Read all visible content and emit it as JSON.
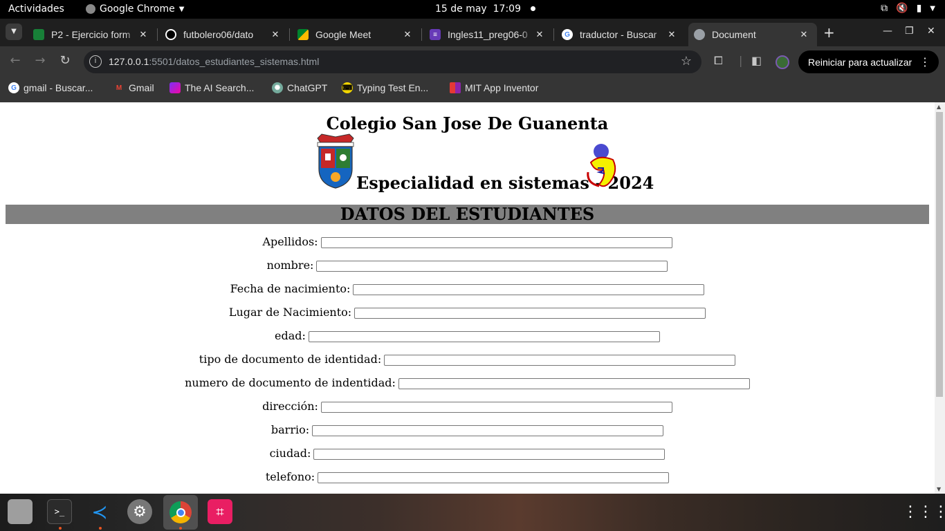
{
  "system_bar": {
    "activities": "Actividades",
    "app_name": "Google Chrome",
    "date": "15 de may",
    "time": "17:09"
  },
  "tabs": [
    {
      "title": "P2 - Ejercicio form",
      "fav_color": "#188038",
      "active": false
    },
    {
      "title": "futbolero06/dato",
      "fav_color": "#000000",
      "active": false
    },
    {
      "title": "Google Meet",
      "fav_color": "#00832d",
      "active": false
    },
    {
      "title": "Ingles11_preg06-0",
      "fav_color": "#673ab7",
      "active": false
    },
    {
      "title": "traductor - Buscar",
      "fav_color": "#4285f4",
      "active": false
    },
    {
      "title": "Document",
      "fav_color": "#9aa0a6",
      "active": true
    }
  ],
  "toolbar": {
    "url_host": "127.0.0.1",
    "url_path": ":5501/datos_estudiantes_sistemas.html",
    "update_label": "Reiniciar para actualizar"
  },
  "bookmarks": [
    {
      "label": "gmail - Buscar...",
      "icon": "google-icon"
    },
    {
      "label": "Gmail",
      "icon": "gmail-icon"
    },
    {
      "label": "The AI Search...",
      "icon": "ai-search-icon"
    },
    {
      "label": "ChatGPT",
      "icon": "chatgpt-icon"
    },
    {
      "label": "Typing Test En...",
      "icon": "typing-test-icon"
    },
    {
      "label": "MIT App Inventor",
      "icon": "app-inventor-icon"
    }
  ],
  "page": {
    "school": "Colegio San Jose De Guanenta",
    "specialty": "Especialidad en sistemas - 2024",
    "banner": "DATOS DEL ESTUDIANTES",
    "fields": [
      {
        "label": "Apellidos:",
        "value": ""
      },
      {
        "label": "nombre:",
        "value": ""
      },
      {
        "label": "Fecha de nacimiento:",
        "value": ""
      },
      {
        "label": "Lugar de Nacimiento:",
        "value": ""
      },
      {
        "label": "edad:",
        "value": ""
      },
      {
        "label": "tipo de documento de identidad:",
        "value": ""
      },
      {
        "label": "numero de documento de indentidad:",
        "value": ""
      },
      {
        "label": "dirección:",
        "value": ""
      },
      {
        "label": "barrio:",
        "value": ""
      },
      {
        "label": "ciudad:",
        "value": ""
      },
      {
        "label": "telefono:",
        "value": ""
      }
    ]
  },
  "colors": {
    "banner_bg": "#808080",
    "chrome_dark": "#353535",
    "tab_strip": "#1f1f1f"
  }
}
